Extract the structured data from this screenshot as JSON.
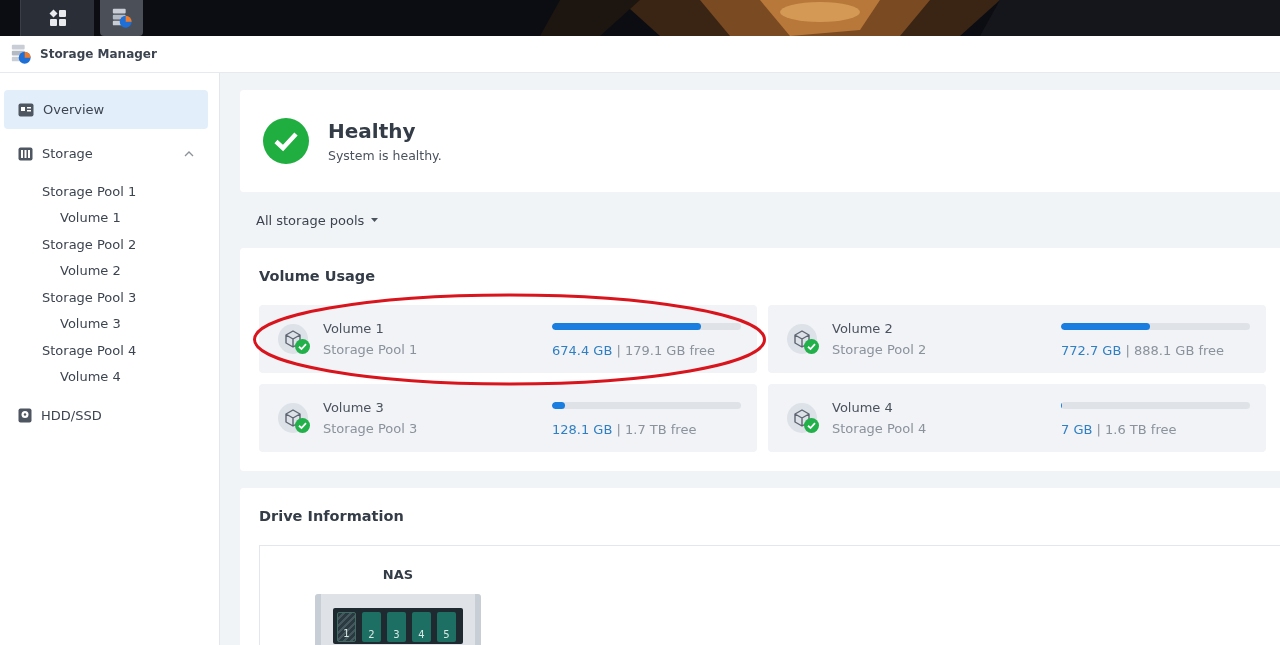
{
  "taskbar": {
    "apps": [
      {
        "selected": false
      },
      {
        "selected": true
      }
    ]
  },
  "app": {
    "title": "Storage Manager"
  },
  "sidebar": {
    "items": [
      {
        "label": "Overview",
        "selected": true
      },
      {
        "label": "Storage",
        "selected": false,
        "expanded": true,
        "children": [
          {
            "label": "Storage Pool 1",
            "selected": false,
            "children": [
              {
                "label": "Volume 1",
                "selected": false
              }
            ]
          },
          {
            "label": "Storage Pool 2",
            "selected": false,
            "children": [
              {
                "label": "Volume 2",
                "selected": false
              }
            ]
          },
          {
            "label": "Storage Pool 3",
            "selected": false,
            "children": [
              {
                "label": "Volume 3",
                "selected": false
              }
            ]
          },
          {
            "label": "Storage Pool 4",
            "selected": false,
            "children": [
              {
                "label": "Volume 4",
                "selected": false
              }
            ]
          }
        ]
      },
      {
        "label": "HDD/SSD",
        "selected": false
      }
    ]
  },
  "health": {
    "title": "Healthy",
    "message": "System is healthy."
  },
  "filter": {
    "label": "All storage pools"
  },
  "volume_usage": {
    "title": "Volume Usage",
    "volumes": [
      {
        "name": "Volume 1",
        "pool": "Storage Pool 1",
        "level": 0.79,
        "used": "674.4 GB",
        "separator": "|",
        "free": "179.1 GB free",
        "highlighted": true
      },
      {
        "name": "Volume 2",
        "pool": "Storage Pool 2",
        "level": 0.47,
        "used": "772.7 GB",
        "separator": "|",
        "free": "888.1 GB free",
        "highlighted": false
      },
      {
        "name": "Volume 3",
        "pool": "Storage Pool 3",
        "level": 0.07,
        "used": "128.1 GB",
        "separator": "|",
        "free": "1.7 TB free",
        "highlighted": false
      },
      {
        "name": "Volume 4",
        "pool": "Storage Pool 4",
        "level": 0.005,
        "used": "7 GB",
        "separator": "|",
        "free": "1.6 TB free",
        "highlighted": false
      }
    ]
  },
  "drive_information": {
    "title": "Drive Information",
    "device": "NAS",
    "bays": [
      {
        "number": "1",
        "kind": "empty"
      },
      {
        "number": "2",
        "kind": "drive"
      },
      {
        "number": "3",
        "kind": "drive"
      },
      {
        "number": "4",
        "kind": "drive"
      },
      {
        "number": "5",
        "kind": "drive"
      }
    ]
  }
}
